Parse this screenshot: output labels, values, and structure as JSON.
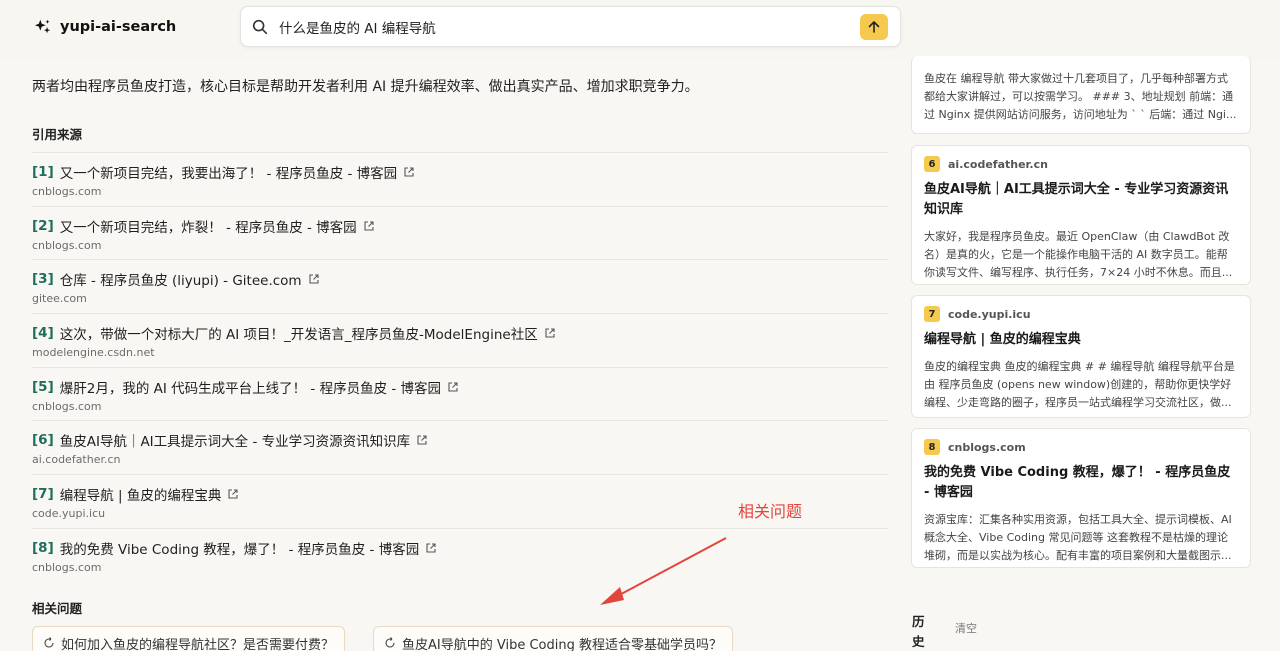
{
  "app": {
    "name": "yupi-ai-search"
  },
  "search": {
    "query": "什么是鱼皮的 AI 编程导航"
  },
  "answer": {
    "summary": "两者均由程序员鱼皮打造，核心目标是帮助开发者利用 AI 提升编程效率、做出真实产品、增加求职竞争力。"
  },
  "sources": {
    "heading": "引用来源",
    "items": [
      {
        "num": "[1]",
        "title": "又一个新项目完结，我要出海了！ - 程序员鱼皮 - 博客园",
        "domain": "cnblogs.com"
      },
      {
        "num": "[2]",
        "title": "又一个新项目完结，炸裂！ - 程序员鱼皮 - 博客园",
        "domain": "cnblogs.com"
      },
      {
        "num": "[3]",
        "title": "仓库 - 程序员鱼皮 (liyupi) - Gitee.com",
        "domain": "gitee.com"
      },
      {
        "num": "[4]",
        "title": "这次，带做一个对标大厂的 AI 项目！_开发语言_程序员鱼皮-ModelEngine社区",
        "domain": "modelengine.csdn.net"
      },
      {
        "num": "[5]",
        "title": "爆肝2月，我的 AI 代码生成平台上线了！ - 程序员鱼皮 - 博客园",
        "domain": "cnblogs.com"
      },
      {
        "num": "[6]",
        "title": "鱼皮AI导航｜AI工具提示词大全 - 专业学习资源资讯知识库",
        "domain": "ai.codefather.cn"
      },
      {
        "num": "[7]",
        "title": "编程导航 | 鱼皮的编程宝典",
        "domain": "code.yupi.icu"
      },
      {
        "num": "[8]",
        "title": "我的免费 Vibe Coding 教程，爆了！ - 程序员鱼皮 - 博客园",
        "domain": "cnblogs.com"
      }
    ]
  },
  "related": {
    "heading": "相关问题",
    "annotation": "相关问题",
    "questions": [
      "如何加入鱼皮的编程导航社区？是否需要付费？",
      "鱼皮AI导航中的 Vibe Coding 教程适合零基础学员吗？"
    ]
  },
  "sidebar": {
    "partial_card": {
      "snippet": "鱼皮在 编程导航 带大家做过十几套项目了，几乎每种部署方式都给大家讲解过，可以按需学习。 ### 3、地址规划 前端：通过 Nginx 提供网站访问服务，访问地址为 ` ` 后端：通过 Ngi..."
    },
    "cards": [
      {
        "num": "6",
        "domain": "ai.codefather.cn",
        "title": "鱼皮AI导航｜AI工具提示词大全 - 专业学习资源资讯知识库",
        "snippet": "大家好，我是程序员鱼皮。最近 OpenClaw（由 ClawdBot 改名）是真的火，它是一个能操作电脑干活的 AI 数字员工。能帮你读写文件、编写程序、执行任务，7×24 小时不休息。而且..."
      },
      {
        "num": "7",
        "domain": "code.yupi.icu",
        "title": "编程导航 | 鱼皮的编程宝典",
        "snippet": "鱼皮的编程宝典 鱼皮的编程宝典 # # 编程导航 编程导航平台是由 程序员鱼皮 (opens new window)创建的，帮助你更快学好编程、少走弯路的圈子，程序员一站式编程学习交流社区，做..."
      },
      {
        "num": "8",
        "domain": "cnblogs.com",
        "title": "我的免费 Vibe Coding 教程，爆了！ - 程序员鱼皮 - 博客园",
        "snippet": "资源宝库：汇集各种实用资源，包括工具大全、提示词模板、AI 概念大全、Vibe Coding 常见问题等 这套教程不是枯燥的理论堆砌，而是以实战为核心。配有丰富的项目案例和大量截图示..."
      }
    ],
    "history_label": "历史",
    "clear_label": "清空"
  },
  "colors": {
    "accent": "#f5c94e",
    "source_num": "#1f6e5b",
    "annotation": "#e2453c"
  }
}
